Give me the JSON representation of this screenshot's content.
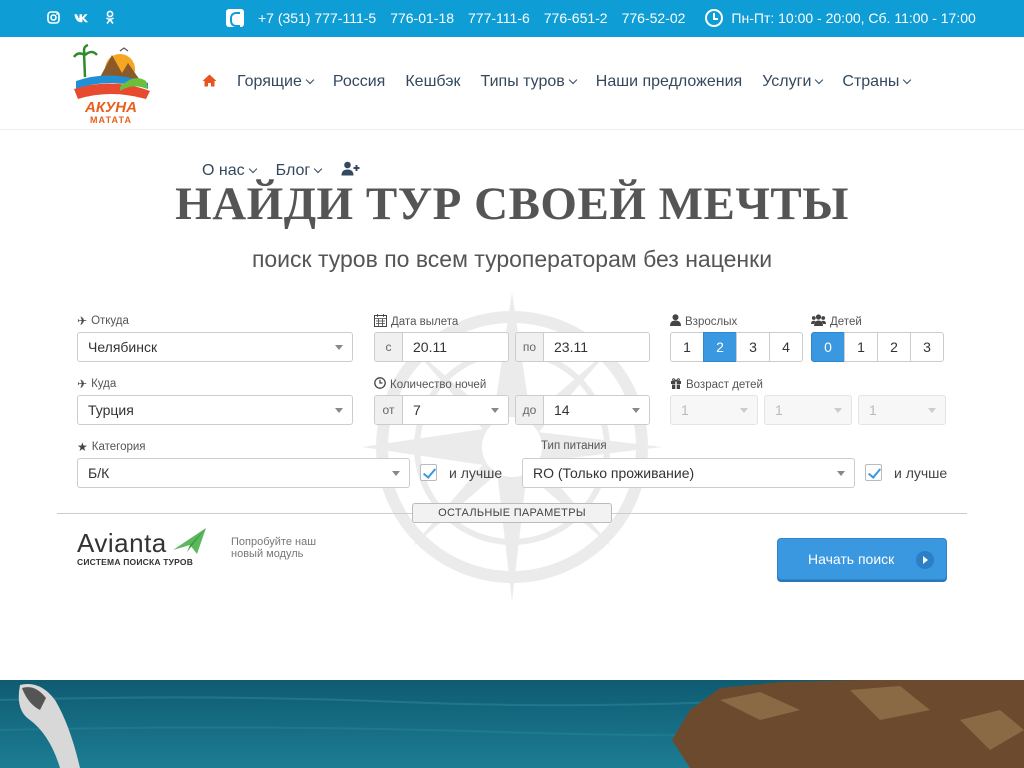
{
  "topbar": {
    "socials": [
      "instagram-icon",
      "vk-icon",
      "odnoklassniki-icon"
    ],
    "phones": [
      "+7 (351) 777-111-5",
      "776-01-18",
      "777-111-6",
      "776-651-2",
      "776-52-02"
    ],
    "hours": "Пн-Пт: 10:00 - 20:00, Сб. 11:00 - 17:00"
  },
  "logo": {
    "line1": "АКУНА",
    "line2": "МАТАТА"
  },
  "nav": {
    "items": [
      "Горящие",
      "Россия",
      "Кешбэк",
      "Типы туров",
      "Наши предложения",
      "Услуги",
      "Страны"
    ],
    "items2": [
      "О нас",
      "Блог"
    ]
  },
  "hero": {
    "title": "НАЙДИ ТУР СВОЕЙ МЕЧТЫ",
    "subtitle": "поиск туров по всем туроператорам без наценки"
  },
  "form": {
    "from_label": "Откуда",
    "from_value": "Челябинск",
    "to_label": "Куда",
    "to_value": "Турция",
    "date_label": "Дата вылета",
    "date_from_prefix": "с",
    "date_from": "20.11",
    "date_to_prefix": "по",
    "date_to": "23.11",
    "nights_label": "Количество ночей",
    "nights_from_prefix": "от",
    "nights_from": "7",
    "nights_to_prefix": "до",
    "nights_to": "14",
    "adults_label": "Взрослых",
    "adults": [
      "1",
      "2",
      "3",
      "4"
    ],
    "adults_selected": "2",
    "kids_label": "Детей",
    "kids": [
      "0",
      "1",
      "2",
      "3"
    ],
    "kids_selected": "0",
    "kids_age_label": "Возраст детей",
    "kids_ages": [
      "1",
      "1",
      "1"
    ],
    "category_label": "Категория",
    "category_value": "Б/К",
    "category_better": "и лучше",
    "meal_label": "Тип питания",
    "meal_value": "RO (Только проживание)",
    "meal_better": "и лучше",
    "more_params": "ОСТАЛЬНЫЕ ПАРАМЕТРЫ",
    "search_button": "Начать поиск"
  },
  "avianta": {
    "name": "Avianta",
    "tagline": "СИСТЕМА ПОИСКА ТУРОВ",
    "try_line1": "Попробуйте наш",
    "try_line2": "новый модуль"
  },
  "colors": {
    "topbar": "#0e9ed5",
    "accent": "#3a98e0",
    "home_icon": "#e8541f"
  }
}
